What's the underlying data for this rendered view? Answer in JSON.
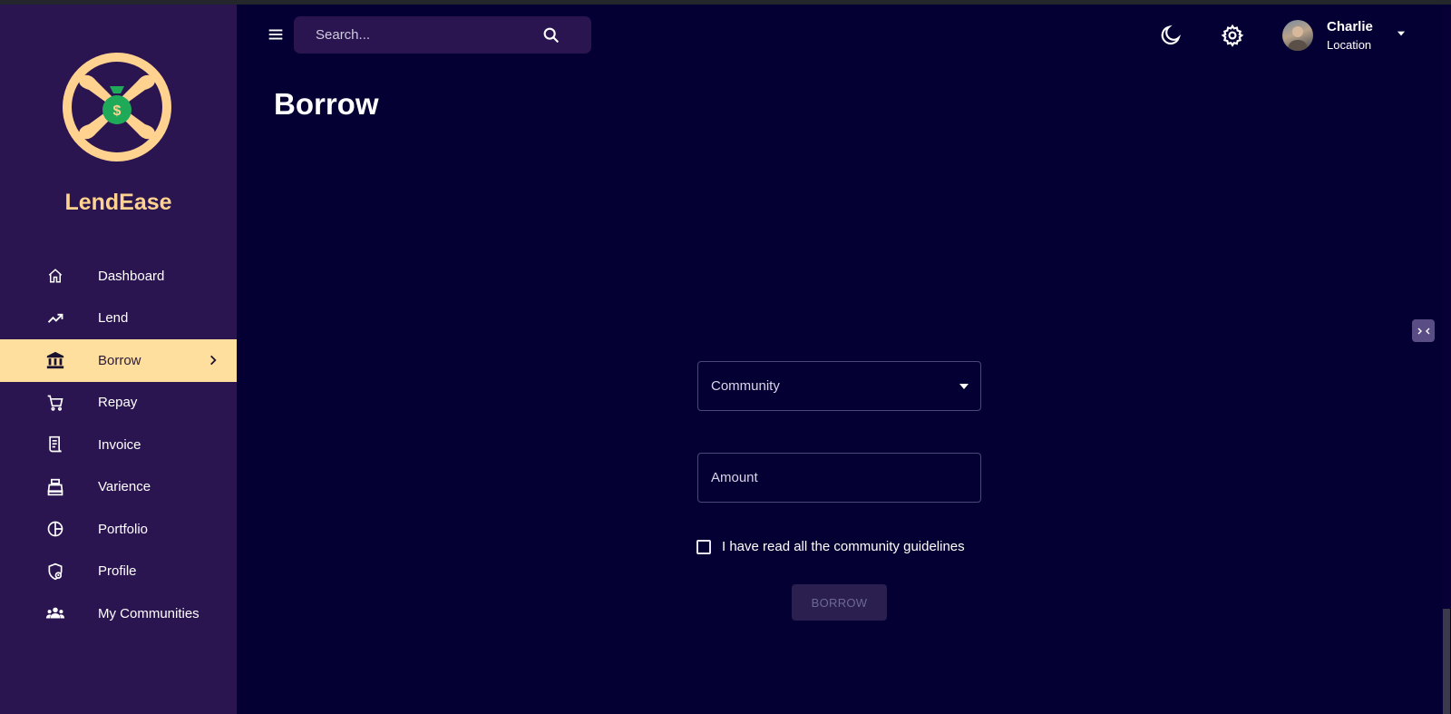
{
  "app": {
    "brand": "LendEase"
  },
  "sidebar": {
    "items": [
      {
        "label": "Dashboard",
        "icon": "home-icon",
        "active": false
      },
      {
        "label": "Lend",
        "icon": "trending-up-icon",
        "active": false
      },
      {
        "label": "Borrow",
        "icon": "bank-icon",
        "active": true
      },
      {
        "label": "Repay",
        "icon": "cart-icon",
        "active": false
      },
      {
        "label": "Invoice",
        "icon": "receipt-icon",
        "active": false
      },
      {
        "label": "Varience",
        "icon": "cash-register-icon",
        "active": false
      },
      {
        "label": "Portfolio",
        "icon": "pie-chart-icon",
        "active": false
      },
      {
        "label": "Profile",
        "icon": "shield-user-icon",
        "active": false
      },
      {
        "label": "My Communities",
        "icon": "groups-icon",
        "active": false
      }
    ]
  },
  "topbar": {
    "search_placeholder": "Search...",
    "user": {
      "name": "Charlie",
      "location": "Location"
    }
  },
  "main": {
    "title": "Borrow",
    "form": {
      "community_label": "Community",
      "amount_placeholder": "Amount",
      "checkbox_label": "I have read all the community guidelines",
      "checkbox_checked": false,
      "submit_label": "BORROW"
    }
  },
  "colors": {
    "background": "#050033",
    "sidebar": "#2b1550",
    "accent": "#ffdf9e",
    "brand_text": "#ffd38f",
    "logo_green": "#1faa59"
  }
}
